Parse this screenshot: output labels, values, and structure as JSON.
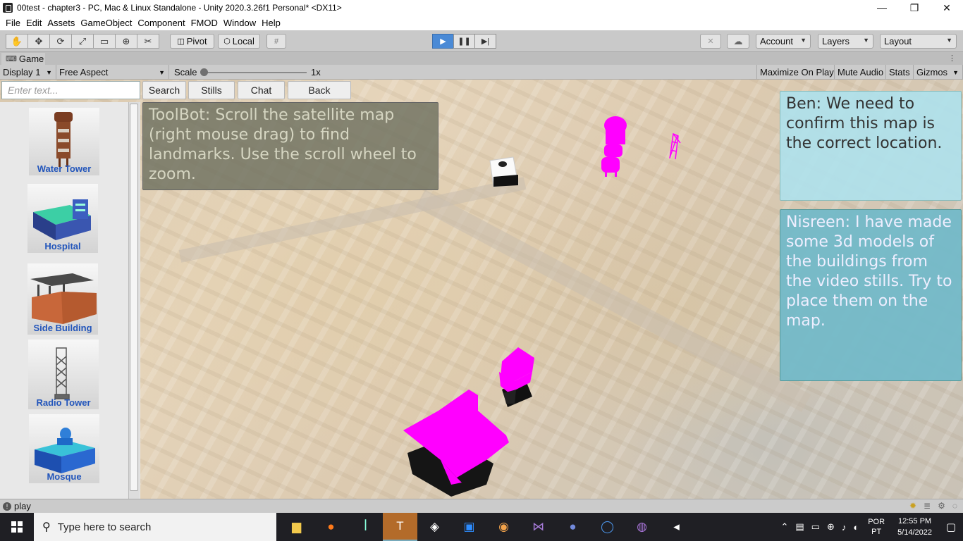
{
  "window": {
    "title": "00test - chapter3 - PC, Mac & Linux Standalone - Unity 2020.3.26f1 Personal* <DX11>",
    "controls": [
      "—",
      "❐",
      "✕"
    ]
  },
  "menu": [
    "File",
    "Edit",
    "Assets",
    "GameObject",
    "Component",
    "FMOD",
    "Window",
    "Help"
  ],
  "toolbar": {
    "pivot_label": "Pivot",
    "local_label": "Local",
    "account_label": "Account",
    "layers_label": "Layers",
    "layout_label": "Layout",
    "play_active": true
  },
  "tab": {
    "label": "Game"
  },
  "gamebar": {
    "display": "Display 1",
    "aspect": "Free Aspect",
    "scale_label": "Scale",
    "scale_value": "1x",
    "maximize": "Maximize On Play",
    "mute": "Mute Audio",
    "stats": "Stats",
    "gizmos": "Gizmos"
  },
  "game": {
    "search_placeholder": "Enter text...",
    "buttons": {
      "search": "Search",
      "stills": "Stills",
      "chat": "Chat",
      "back": "Back"
    },
    "cards": [
      {
        "label": "Water Tower"
      },
      {
        "label": "Hospital"
      },
      {
        "label": "Side Building"
      },
      {
        "label": "Radio Tower"
      },
      {
        "label": "Mosque"
      }
    ],
    "toolbot_message": "ToolBot: Scroll the satellite map (right mouse drag) to find landmarks. Use the scroll wheel to zoom.",
    "ben_message": "Ben: We need to confirm this map is the correct location.",
    "nisreen_message": "Nisreen: I have made some 3d models of the buildings from the video stills. Try to place them on the map.",
    "model_color": "#ff00ff"
  },
  "status": {
    "text": "play"
  },
  "taskbar": {
    "search_placeholder": "Type here to search",
    "lang_top": "POR",
    "lang_bottom": "PT",
    "time": "12:55 PM",
    "date": "5/14/2022"
  }
}
